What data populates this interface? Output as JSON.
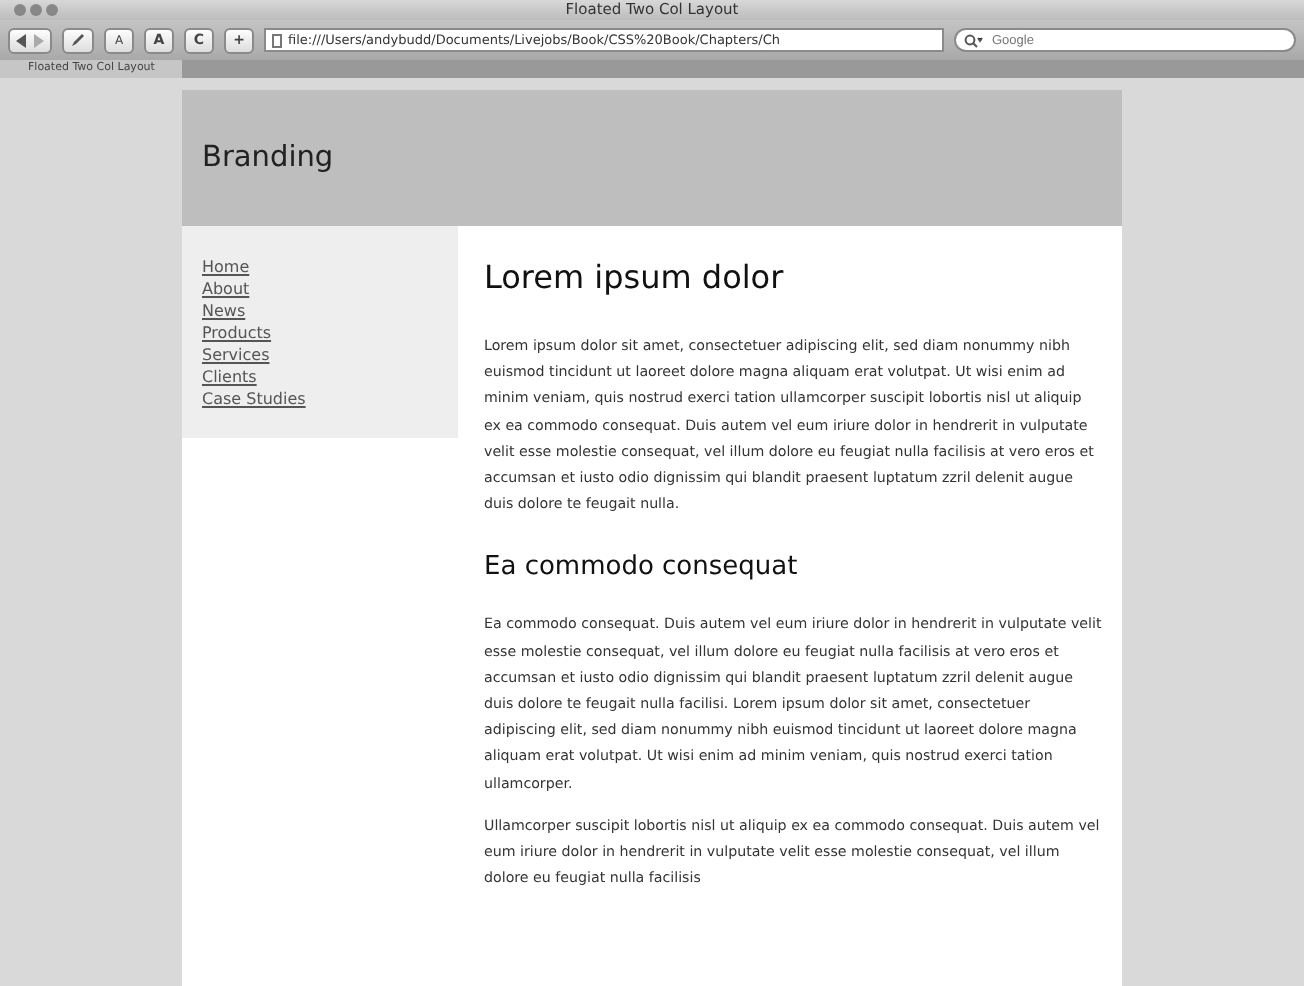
{
  "window": {
    "title": "Floated Two Col Layout"
  },
  "toolbar": {
    "address": "file:///Users/andybudd/Documents/Livejobs/Book/CSS%20Book/Chapters/Ch",
    "search": {
      "placeholder": "Google"
    },
    "text_smaller": "A",
    "text_bigger": "A",
    "reload": "C",
    "add": "+"
  },
  "tabs": [
    {
      "label": "Floated Two Col Layout",
      "selected": true
    }
  ],
  "page": {
    "branding": "Branding",
    "nav": [
      {
        "label": "Home"
      },
      {
        "label": "About"
      },
      {
        "label": "News"
      },
      {
        "label": "Products"
      },
      {
        "label": "Services"
      },
      {
        "label": "Clients"
      },
      {
        "label": "Case Studies"
      }
    ],
    "content": [
      {
        "kind": "heading",
        "text": "Lorem ipsum dolor"
      },
      {
        "kind": "paragraph",
        "text": "Lorem ipsum dolor sit amet, consectetuer adipiscing elit, sed diam nonummy nibh euismod tincidunt ut laoreet dolore magna aliquam erat volutpat. Ut wisi enim ad minim veniam, quis nostrud exerci tation ullamcorper suscipit lobortis nisl ut aliquip ex ea commodo consequat. Duis autem vel eum iriure dolor in hendrerit in vulputate velit esse molestie consequat, vel illum dolore eu feugiat nulla facilisis at vero eros et accumsan et iusto odio dignissim qui blandit praesent luptatum zzril delenit augue duis dolore te feugait nulla."
      },
      {
        "kind": "subheading",
        "text": "Ea commodo consequat"
      },
      {
        "kind": "paragraph",
        "text": "Ea commodo consequat. Duis autem vel eum iriure dolor in hendrerit in vulputate velit esse molestie consequat, vel illum dolore eu feugiat nulla facilisis at vero eros et accumsan et iusto odio dignissim qui blandit praesent luptatum zzril delenit augue duis dolore te feugait nulla facilisi. Lorem ipsum dolor sit amet, consectetuer adipiscing elit, sed diam nonummy nibh euismod tincidunt ut laoreet dolore magna aliquam erat volutpat. Ut wisi enim ad minim veniam, quis nostrud exerci tation ullamcorper."
      },
      {
        "kind": "paragraph",
        "text": "Ullamcorper suscipit lobortis nisl ut aliquip ex ea commodo consequat. Duis autem vel eum iriure dolor in hendrerit in vulputate velit esse molestie consequat, vel illum dolore eu feugiat nulla facilisis"
      }
    ]
  }
}
